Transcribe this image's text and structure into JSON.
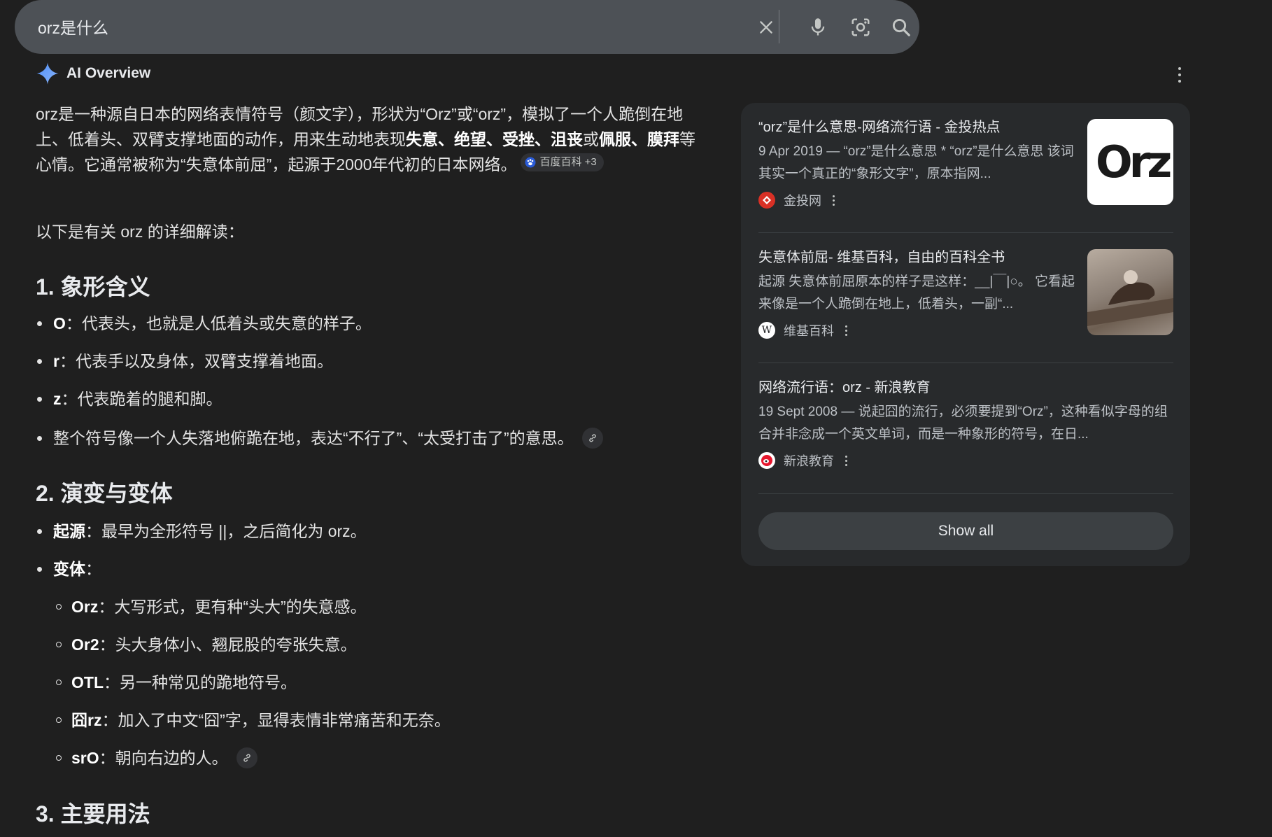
{
  "search": {
    "query": "orz是什么"
  },
  "ai_overview": {
    "title": "AI Overview"
  },
  "intro": {
    "t1": "orz是一种源自日本的网络表情符号（颜文字），形状为“Orz”或“orz”，模拟了一个人跪倒在地上、低着头、双臂支撑地面的动作，用来生动地表现",
    "b1": "失意",
    "sep1": "、",
    "b2": "绝望",
    "sep2": "、",
    "b3": "受挫",
    "sep3": "、",
    "b4": "沮丧",
    "t2": "或",
    "b5": "佩服",
    "sep4": "、",
    "b6": "膜拜",
    "t3": "等心情。它通常被称为“失意体前屈”，起源于2000年代初的日本网络。",
    "citation": "百度百科 +3"
  },
  "intro2": "以下是有关 orz 的详细解读：",
  "section1": {
    "heading": "1. 象形含义",
    "items": [
      {
        "key": "O",
        "text": "：代表头，也就是人低着头或失意的样子。"
      },
      {
        "key": "r",
        "text": "：代表手以及身体，双臂支撑着地面。"
      },
      {
        "key": "z",
        "text": "：代表跪着的腿和脚。"
      },
      {
        "key": "",
        "text": "整个符号像一个人失落地俯跪在地，表达“不行了”、“太受打击了”的意思。"
      }
    ]
  },
  "section2": {
    "heading": "2. 演变与变体",
    "origin_key": "起源",
    "origin_text": "：最早为全形符号 ||，之后简化为 orz。",
    "variants_key": "变体",
    "variants_colon": "：",
    "variants": [
      {
        "key": "Orz",
        "text": "：大写形式，更有种“头大”的失意感。"
      },
      {
        "key": "Or2",
        "text": "：头大身体小、翘屁股的夸张失意。"
      },
      {
        "key": "OTL",
        "text": "：另一种常见的跪地符号。"
      },
      {
        "key": "囧rz",
        "text": "：加入了中文“囧”字，显得表情非常痛苦和无奈。"
      },
      {
        "key": "srO",
        "text": "：朝向右边的人。"
      }
    ]
  },
  "section3": {
    "heading": "3. 主要用法"
  },
  "sources": [
    {
      "title": "“orz”是什么意思-网络流行语 - 金投热点",
      "snippet": "9 Apr 2019 — “orz”是什么意思 * “orz”是什么意思 该词其实一个真正的“象形文字”，原本指网...",
      "site": "金投网",
      "favicon_color": "#d93025",
      "thumb_text": "Orz"
    },
    {
      "title": "失意体前屈- 维基百科，自由的百科全书",
      "snippet": "起源 失意体前屈原本的样子是这样：__|￣|○。 它看起来像是一个人跪倒在地上，低着头，一副“...",
      "site": "维基百科",
      "favicon_letter": "W"
    },
    {
      "title": "网络流行语：orz - 新浪教育",
      "snippet": "19 Sept 2008 — 说起囧的流行，必须要提到“Orz”，这种看似字母的组合并非念成一个英文单词，而是一种象形的符号，在日...",
      "site": "新浪教育"
    }
  ],
  "show_all": "Show all",
  "colors": {
    "background": "#1f1f1f",
    "searchbar": "#4d5156",
    "panel": "#282a2c",
    "gemini_blue": "#4f8ef7"
  }
}
